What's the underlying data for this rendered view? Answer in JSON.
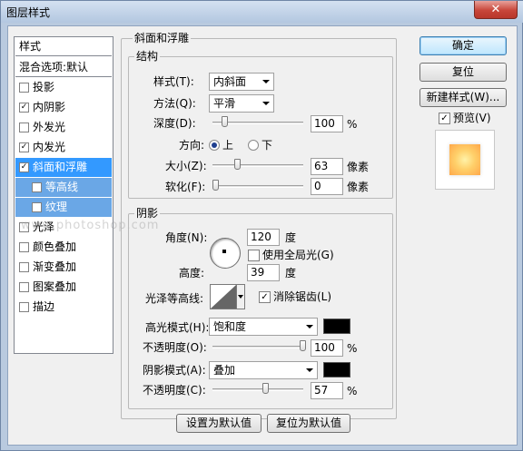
{
  "window": {
    "title": "图层样式",
    "close_glyph": "✕"
  },
  "style_list": {
    "header": "样式",
    "blend_options": "混合选项:默认",
    "items": [
      {
        "label": "投影",
        "checked": false
      },
      {
        "label": "内阴影",
        "checked": true
      },
      {
        "label": "外发光",
        "checked": false
      },
      {
        "label": "内发光",
        "checked": true
      },
      {
        "label": "斜面和浮雕",
        "checked": true,
        "selected": true
      },
      {
        "label": "等高线",
        "checked": false,
        "sub": true
      },
      {
        "label": "纹理",
        "checked": false,
        "sub": true
      },
      {
        "label": "光泽",
        "checked": false
      },
      {
        "label": "颜色叠加",
        "checked": false
      },
      {
        "label": "渐变叠加",
        "checked": false
      },
      {
        "label": "图案叠加",
        "checked": false
      },
      {
        "label": "描边",
        "checked": false
      }
    ]
  },
  "bevel": {
    "title": "斜面和浮雕",
    "structure": {
      "title": "结构",
      "style_label": "样式(T):",
      "style_value": "内斜面",
      "technique_label": "方法(Q):",
      "technique_value": "平滑",
      "depth_label": "深度(D):",
      "depth_value": "100",
      "depth_unit": "%",
      "depth_level": 0.1,
      "direction_label": "方向:",
      "direction_up": "上",
      "direction_down": "下",
      "direction_selected": "上",
      "size_label": "大小(Z):",
      "size_value": "63",
      "size_unit": "像素",
      "size_level": 0.25,
      "soften_label": "软化(F):",
      "soften_value": "0",
      "soften_unit": "像素",
      "soften_level": 0.0
    },
    "shading": {
      "title": "阴影",
      "angle_label": "角度(N):",
      "angle_value": "120",
      "angle_unit": "度",
      "global_light_label": "使用全局光(G)",
      "global_light_checked": false,
      "altitude_label": "高度:",
      "altitude_value": "39",
      "altitude_unit": "度",
      "gloss_contour_label": "光泽等高线:",
      "anti_alias_label": "消除锯齿(L)",
      "anti_alias_checked": true,
      "highlight_mode_label": "高光模式(H):",
      "highlight_mode_value": "饱和度",
      "highlight_color": "#000000",
      "highlight_opacity_label": "不透明度(O):",
      "highlight_opacity_value": "100",
      "highlight_opacity_level": 1.0,
      "shadow_mode_label": "阴影模式(A):",
      "shadow_mode_value": "叠加",
      "shadow_color": "#000000",
      "shadow_opacity_label": "不透明度(C):",
      "shadow_opacity_value": "57",
      "shadow_opacity_level": 0.57,
      "percent": "%"
    },
    "make_default": "设置为默认值",
    "reset_default": "复位为默认值"
  },
  "buttons": {
    "ok": "确定",
    "reset": "复位",
    "new_style": "新建样式(W)...",
    "preview_label": "预览(V)",
    "preview_checked": true
  },
  "watermark": "www.photoshop.com"
}
